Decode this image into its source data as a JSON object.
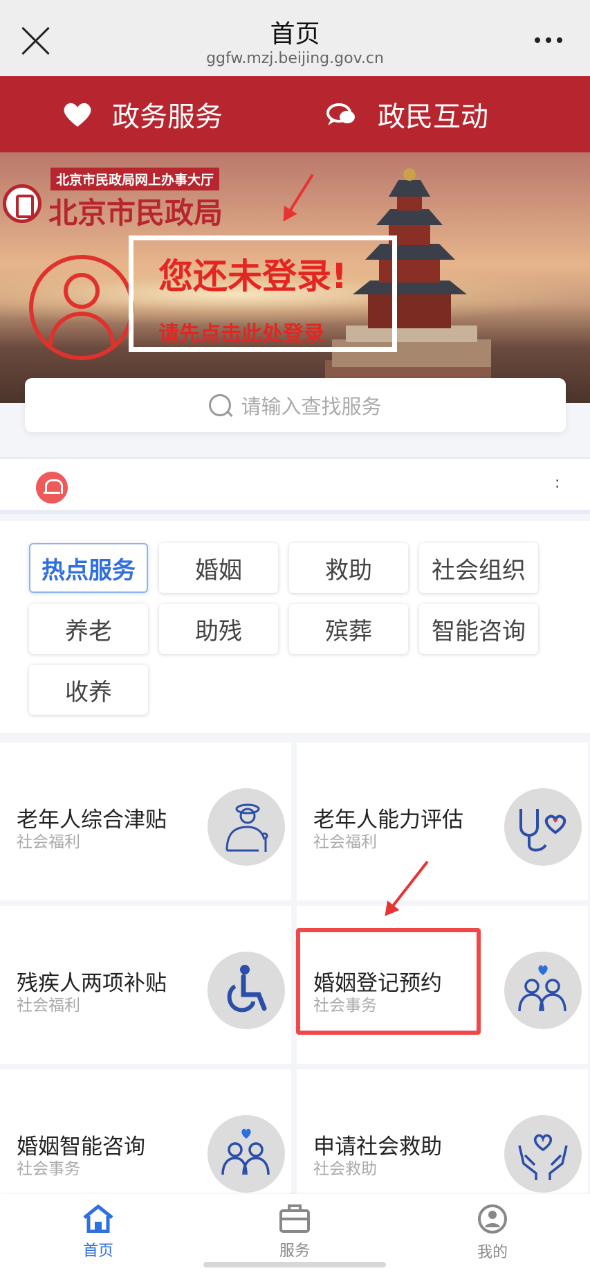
{
  "browser": {
    "title": "首页",
    "url": "ggfw.mzj.beijing.gov.cn"
  },
  "tabs": {
    "left": "政务服务",
    "right": "政民互动"
  },
  "banner": {
    "org_subtitle": "北京市民政局网上办事大厅",
    "org_name": "北京市民政局",
    "login_title": "您还未登录!",
    "login_hint": "请先点击此处登录"
  },
  "search": {
    "placeholder": "请输入查找服务"
  },
  "notice": {
    "text": ":"
  },
  "categories": [
    {
      "label": "热点服务",
      "active": true
    },
    {
      "label": "婚姻",
      "active": false
    },
    {
      "label": "救助",
      "active": false
    },
    {
      "label": "社会组织",
      "active": false
    },
    {
      "label": "养老",
      "active": false
    },
    {
      "label": "助残",
      "active": false
    },
    {
      "label": "殡葬",
      "active": false
    },
    {
      "label": "智能咨询",
      "active": false
    },
    {
      "label": "收养",
      "active": false
    }
  ],
  "services": [
    {
      "title": "老年人综合津贴",
      "category": "社会福利",
      "icon": "elderly-person-icon"
    },
    {
      "title": "老年人能力评估",
      "category": "社会福利",
      "icon": "stethoscope-heart-icon"
    },
    {
      "title": "残疾人两项补贴",
      "category": "社会福利",
      "icon": "wheelchair-icon"
    },
    {
      "title": "婚姻登记预约",
      "category": "社会事务",
      "icon": "couple-heart-icon"
    },
    {
      "title": "婚姻智能咨询",
      "category": "社会事务",
      "icon": "couple-heart-icon"
    },
    {
      "title": "申请社会救助",
      "category": "社会救助",
      "icon": "hands-heart-icon"
    }
  ],
  "bottom_nav": [
    {
      "label": "首页",
      "active": true
    },
    {
      "label": "服务",
      "active": false
    },
    {
      "label": "我的",
      "active": false
    }
  ],
  "colors": {
    "brand_red": "#b7262e",
    "accent_blue": "#2f6fe0",
    "annotation_red": "#f04848",
    "icon_blue": "#2b4ea8"
  }
}
